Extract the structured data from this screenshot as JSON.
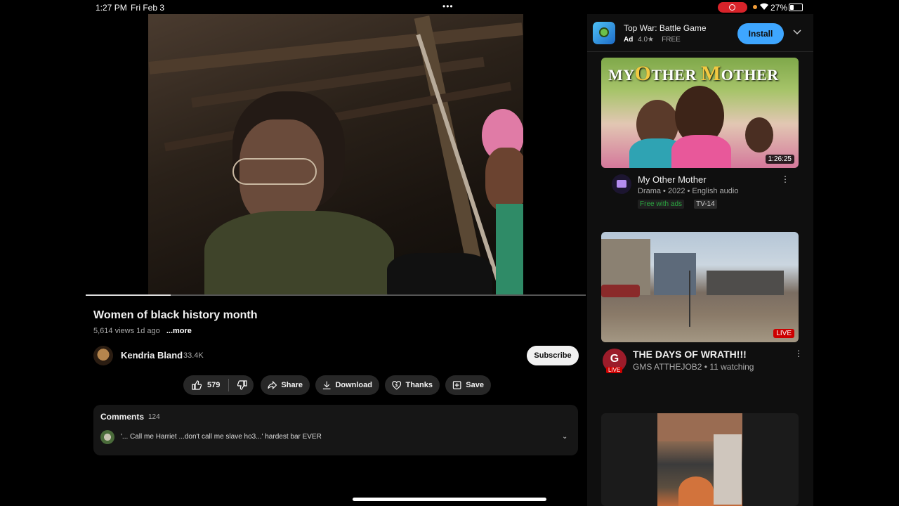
{
  "status_bar": {
    "time": "1:27 PM",
    "date": "Fri Feb 3",
    "battery": "27%",
    "dots": "•••"
  },
  "video": {
    "title": "Women of black history month",
    "meta": "5,614 views  1d ago",
    "more": "...more",
    "progress": 0.17
  },
  "channel": {
    "name": "Kendria Bland",
    "subscribers": "33.4K",
    "subscribe_label": "Subscribe"
  },
  "actions": {
    "likes": "579",
    "share": "Share",
    "download": "Download",
    "thanks": "Thanks",
    "save": "Save"
  },
  "comments": {
    "title": "Comments",
    "count": "124",
    "top_comment": "'... Call me Harriet ...don't call me slave ho3...' hardest bar EVER"
  },
  "ad": {
    "title": "Top War: Battle Game",
    "label": "Ad",
    "rating": "4.0★",
    "price": "FREE",
    "install": "Install"
  },
  "recommendations": [
    {
      "thumb_text_a": "MY",
      "thumb_text_b": "O",
      "thumb_text_c": "THER ",
      "thumb_text_d": "M",
      "thumb_text_e": "OTHER",
      "duration": "1:26:25",
      "title": "My Other Mother",
      "meta": "Drama • 2022 • English audio",
      "badge_free": "Free with ads",
      "badge_rating": "TV-14"
    },
    {
      "badge": "LIVE",
      "channel_initial": "G",
      "channel_live": "LIVE",
      "title": "THE DAYS OF WRATH!!!",
      "meta": "GMS ATTHEJOB2 • 11 watching"
    }
  ],
  "colors": {
    "accent_blue": "#3ea6ff",
    "live_red": "#cc0000",
    "free_green": "#2ba640"
  }
}
